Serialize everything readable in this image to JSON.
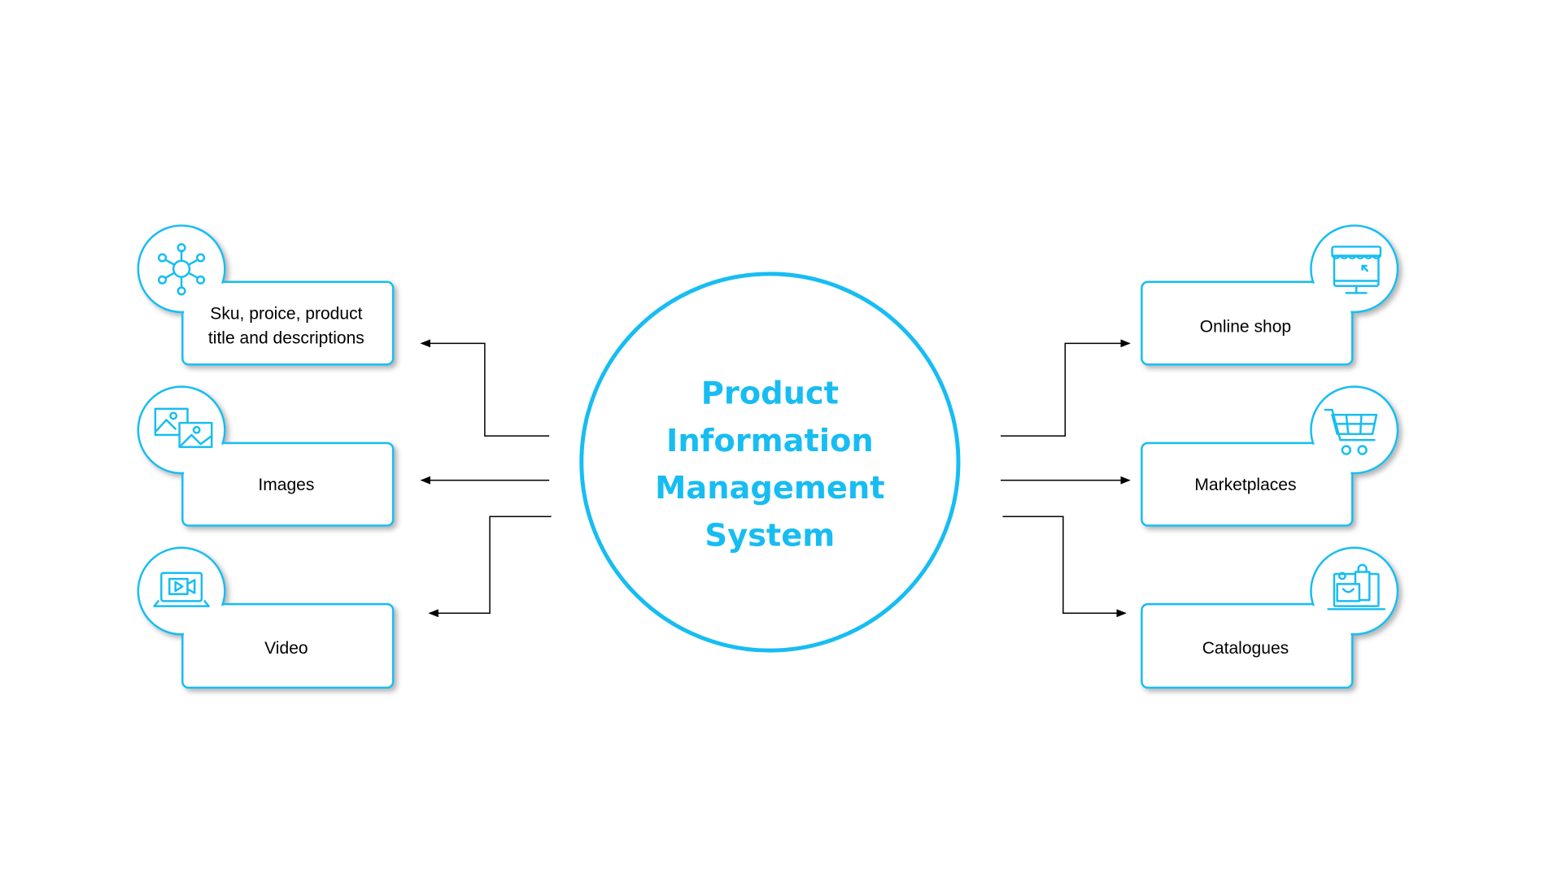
{
  "colors": {
    "accent": "#17BDF2",
    "text": "#000000",
    "background": "#FFFFFF"
  },
  "center": {
    "lines": [
      "Product",
      "Information",
      "Management",
      "System"
    ]
  },
  "inputs": [
    {
      "lines": [
        "Sku, proice, product",
        "title and descriptions"
      ],
      "icon": "network-hub-icon"
    },
    {
      "lines": [
        "Images"
      ],
      "icon": "images-icon"
    },
    {
      "lines": [
        "Video"
      ],
      "icon": "laptop-video-icon"
    }
  ],
  "outputs": [
    {
      "lines": [
        "Online shop"
      ],
      "icon": "online-store-monitor-icon"
    },
    {
      "lines": [
        "Marketplaces"
      ],
      "icon": "shopping-cart-icon"
    },
    {
      "lines": [
        "Catalogues"
      ],
      "icon": "laptop-shopping-icon"
    }
  ]
}
